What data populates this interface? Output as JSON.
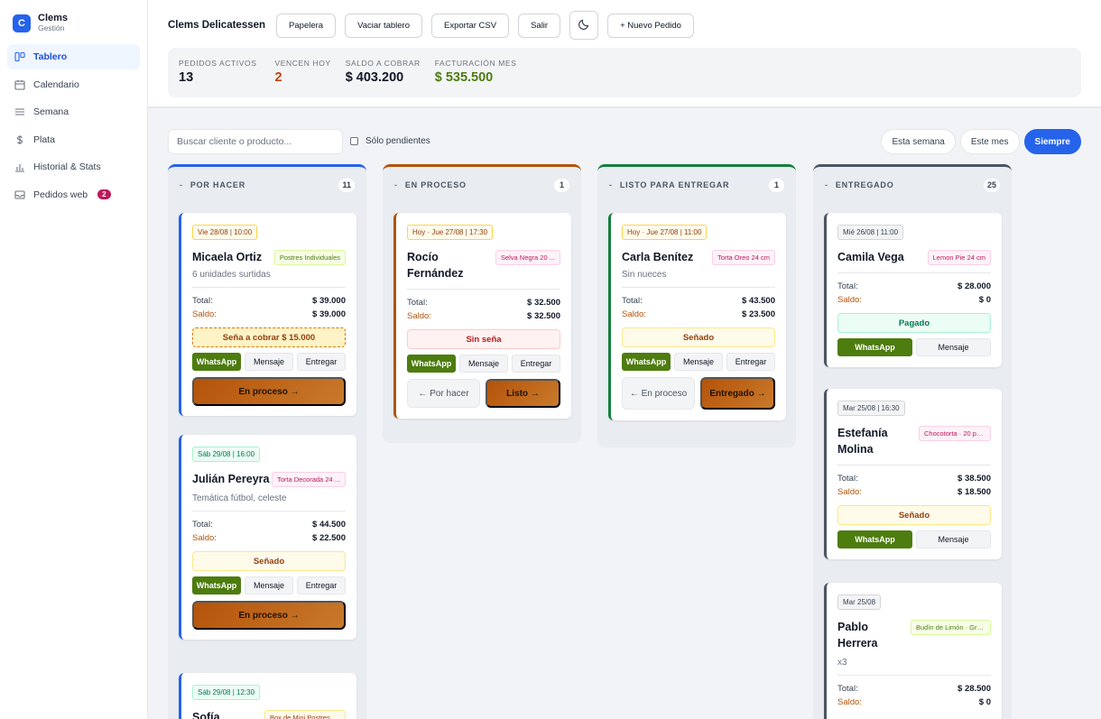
{
  "brand": {
    "logo": "C",
    "name": "Clems",
    "subtitle": "Gestión"
  },
  "sidebar": {
    "items": [
      {
        "label": "Tablero",
        "icon": "board-icon",
        "active": true
      },
      {
        "label": "Calendario",
        "icon": "calendar-icon"
      },
      {
        "label": "Semana",
        "icon": "list-icon"
      },
      {
        "label": "Plata",
        "icon": "dollar-icon"
      },
      {
        "label": "Historial & Stats",
        "icon": "bar-chart-icon"
      },
      {
        "label": "Pedidos web",
        "icon": "inbox-icon",
        "badge": "2"
      }
    ]
  },
  "header": {
    "title": "Clems Delicatessen",
    "buttons": {
      "trash": "Papelera",
      "clear": "Vaciar tablero",
      "export": "Exportar CSV",
      "exit": "Salir",
      "theme": "moon-icon",
      "new_order": "+ Nuevo Pedido"
    }
  },
  "stats": [
    {
      "label": "PEDIDOS ACTIVOS",
      "value": "13",
      "color": "#111827"
    },
    {
      "label": "VENCEN HOY",
      "value": "2",
      "color": "#c2410c"
    },
    {
      "label": "SALDO A COBRAR",
      "value": "$ 403.200",
      "color": "#111827"
    },
    {
      "label": "FACTURACIÓN MES",
      "value": "$ 535.500",
      "color": "#4d7c0f"
    }
  ],
  "filters": {
    "search_placeholder": "Buscar cliente o producto...",
    "only_pending": "Sólo pendientes",
    "ranges": [
      "Esta semana",
      "Este mes",
      "Siempre"
    ],
    "active_range": "Siempre"
  },
  "columns": [
    {
      "title": "POR HACER",
      "count": "11",
      "color": "#2563eb",
      "cards": [
        {
          "date": "Vie 28/08 | 10:00",
          "name": "Micaela Ortiz",
          "product": "Postres Individuales",
          "note": "6 unidades surtidas",
          "total_label": "Total:",
          "total": "$ 39.000",
          "saldo_label": "Saldo:",
          "saldo": "$ 39.000",
          "status": "Seña a cobrar $ 15.000",
          "whatsapp": "WhatsApp",
          "message": "Mensaje",
          "deliver": "Entregar",
          "forward": "En proceso →"
        },
        {
          "date": "Sáb 29/08 | 16:00",
          "name": "Julián Pereyra",
          "product": "Torta Decorada 24 ...",
          "note": "Temática fútbol, celeste",
          "total_label": "Total:",
          "total": "$ 44.500",
          "saldo_label": "Saldo:",
          "saldo": "$ 22.500",
          "status": "Señado",
          "whatsapp": "WhatsApp",
          "message": "Mensaje",
          "deliver": "Entregar",
          "forward": "En proceso →"
        },
        {
          "date": "Sáb 29/08 | 12:30",
          "name": "Sofía",
          "product": "Box de Mini Postres - ..."
        }
      ]
    },
    {
      "title": "EN PROCESO",
      "count": "1",
      "color": "#b45309",
      "cards": [
        {
          "date": "Hoy · Jue 27/08 | 17:30",
          "name": "Rocío Fernández",
          "product": "Selva Negra 20 ...",
          "total_label": "Total:",
          "total": "$ 32.500",
          "saldo_label": "Saldo:",
          "saldo": "$ 32.500",
          "status": "Sin seña",
          "whatsapp": "WhatsApp",
          "message": "Mensaje",
          "deliver": "Entregar",
          "back": "← Por hacer",
          "forward": "Listo →"
        }
      ]
    },
    {
      "title": "LISTO PARA ENTREGAR",
      "count": "1",
      "color": "#15803d",
      "cards": [
        {
          "date": "Hoy · Jue 27/08 | 11:00",
          "name": "Carla Benítez",
          "product": "Torta Oreo 24 cm",
          "note": "Sin nueces",
          "total_label": "Total:",
          "total": "$ 43.500",
          "saldo_label": "Saldo:",
          "saldo": "$ 23.500",
          "status": "Señado",
          "whatsapp": "WhatsApp",
          "message": "Mensaje",
          "deliver": "Entregar",
          "back": "← En proceso",
          "forward": "Entregado →"
        }
      ]
    },
    {
      "title": "ENTREGADO",
      "count": "25",
      "color": "#4b5563",
      "cards": [
        {
          "date": "Mié 26/08 | 11:00",
          "name": "Camila Vega",
          "product": "Lemon Pie 24 cm",
          "total_label": "Total:",
          "total": "$ 28.000",
          "saldo_label": "Saldo:",
          "saldo": "$ 0",
          "status": "Pagado",
          "whatsapp": "WhatsApp",
          "message": "Mensaje"
        },
        {
          "date": "Mar 25/08 | 16:30",
          "name": "Estefanía Molina",
          "product": "Chocotorta · 20 po...",
          "total_label": "Total:",
          "total": "$ 38.500",
          "saldo_label": "Saldo:",
          "saldo": "$ 18.500",
          "status": "Señado",
          "whatsapp": "WhatsApp",
          "message": "Mensaje"
        },
        {
          "date": "Mar 25/08",
          "name": "Pablo Herrera",
          "product": "Budín de Limón · Gra...",
          "note": "x3",
          "total_label": "Total:",
          "total": "$ 28.500",
          "saldo_label": "Saldo:",
          "saldo": "$ 0"
        }
      ]
    }
  ]
}
